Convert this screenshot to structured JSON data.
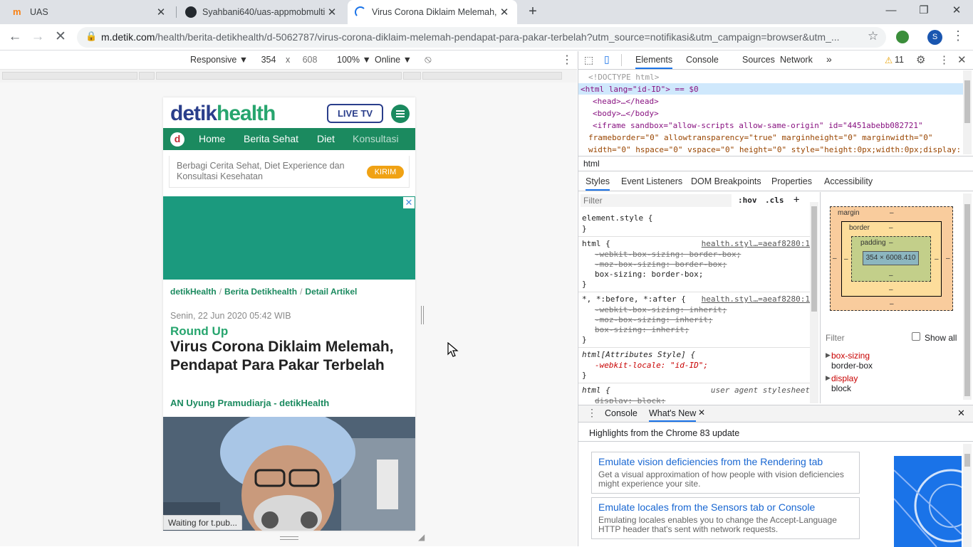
{
  "tabs": [
    {
      "title": "UAS",
      "icon": "moodle-icon"
    },
    {
      "title": "Syahbani640/uas-appmobmulti",
      "icon": "github-icon"
    },
    {
      "title": "Virus Corona Diklaim Melemah, P",
      "icon": "loading-icon",
      "active": true
    }
  ],
  "address": {
    "domain": "m.detik.com",
    "path": "/health/berita-detikhealth/d-5062787/virus-corona-diklaim-melemah-pendapat-para-pakar-terbelah?utm_source=notifikasi&utm_campaign=browser&utm_..."
  },
  "profile_initial": "S",
  "device_toolbar": {
    "mode": "Responsive ▼",
    "width": "354",
    "times": "x",
    "height": "608",
    "zoom": "100% ▼",
    "network": "Online ▼"
  },
  "mobile_page": {
    "logo_dark": "detik",
    "logo_green": "health",
    "live_tv": "LIVE TV",
    "brand_mark": "d",
    "nav": [
      "Home",
      "Berita Sehat",
      "Diet",
      "Konsultasi"
    ],
    "promo_text": "Berbagi Cerita Sehat, Diet Experience dan Konsultasi Kesehatan",
    "promo_button": "KIRIM",
    "ad_close": "✕",
    "breadcrumb": [
      "detikHealth",
      "Berita Detikhealth",
      "Detail Artikel"
    ],
    "breadcrumb_sep": "/",
    "date": "Senin, 22 Jun 2020 05:42 WIB",
    "kicker": "Round Up",
    "headline": "Virus Corona Diklaim Melemah, Pendapat Para Pakar Terbelah",
    "author": "AN Uyung Pramudiarja - detikHealth"
  },
  "status_text": "Waiting for t.pub...",
  "devtools": {
    "tabs": [
      "Elements",
      "Console",
      "Sources",
      "Network"
    ],
    "more": "»",
    "warnings": "11",
    "dom_lines": [
      "<!DOCTYPE html>",
      "<html lang=\"id-ID\"> == $0",
      "<head>…</head>",
      "<body>…</body>",
      "<iframe sandbox=\"allow-scripts allow-same-origin\" id=\"4451abebb082721\"",
      "frameborder=\"0\" allowtransparency=\"true\" marginheight=\"0\" marginwidth=\"0\"",
      "width=\"0\" hspace=\"0\" vspace=\"0\" height=\"0\" style=\"height:0px;width:0px;display:"
    ],
    "breadcrumb": "html",
    "subtabs": [
      "Styles",
      "Event Listeners",
      "DOM Breakpoints",
      "Properties",
      "Accessibility"
    ],
    "filter_placeholder": "Filter",
    "hov": ":hov",
    "cls": ".cls",
    "plus": "+",
    "style_rules": {
      "element_style": "element.style {",
      "close": "}",
      "html_sel": "html {",
      "html_src": "health.styl…=aeaf8280:1",
      "webkit_box": "-webkit-box-sizing: border-box;",
      "moz_box": "-moz-box-sizing: border-box;",
      "box": "box-sizing: border-box;",
      "star_sel": "*, *:before, *:after {",
      "star_src": "health.styl…=aeaf8280:1",
      "webkit_inherit": "-webkit-box-sizing: inherit;",
      "moz_inherit": "-moz-box-sizing: inherit;",
      "box_inherit": "box-sizing: inherit;",
      "attr_sel": "html[Attributes Style] {",
      "locale": "-webkit-locale: \"id-ID\";",
      "ua_sel": "html {",
      "ua_src": "user agent stylesheet",
      "ua_display": "display: block;"
    },
    "box_model": {
      "margin": "margin",
      "border": "border",
      "padding": "padding",
      "dash": "–",
      "content": "354 × 6008.410"
    },
    "computed_filter": "Filter",
    "show_all": "Show all",
    "computed": [
      {
        "prop": "box-sizing",
        "value": "border-box"
      },
      {
        "prop": "display",
        "value": "block"
      },
      {
        "prop": "height",
        "value": ""
      }
    ],
    "drawer_tabs": [
      "Console",
      "What's New"
    ],
    "highlights": "Highlights from the Chrome 83 update",
    "cards": [
      {
        "title": "Emulate vision deficiencies from the Rendering tab",
        "desc": "Get a visual approximation of how people with vision deficiencies might experience your site."
      },
      {
        "title": "Emulate locales from the Sensors tab or Console",
        "desc": "Emulating locales enables you to change the Accept-Language HTTP header that's sent with network requests."
      }
    ]
  },
  "colors": {
    "detik_blue": "#2a3e8b",
    "detik_green": "#1b8a5f",
    "kirim_orange": "#f0a214",
    "devtools_accent": "#1a73e8"
  }
}
